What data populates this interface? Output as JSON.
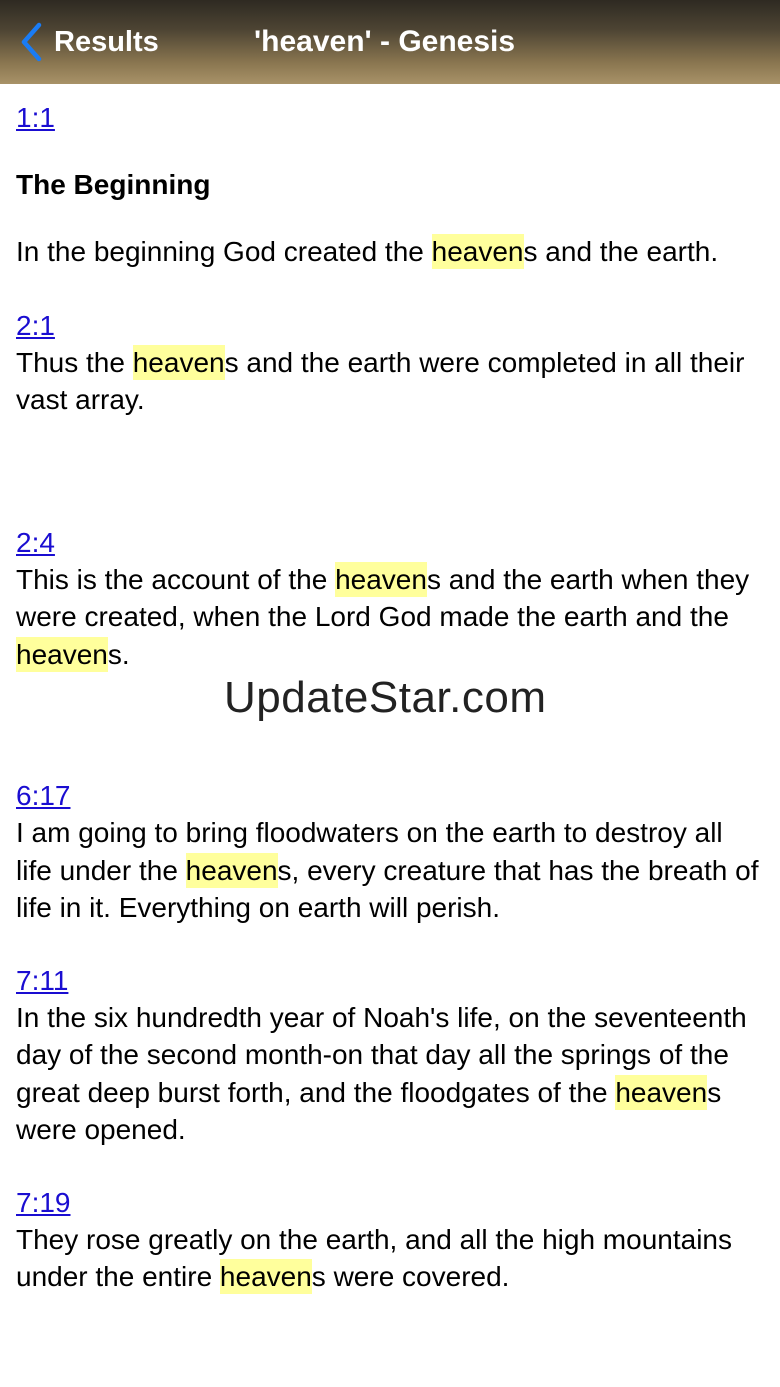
{
  "nav": {
    "back_label": "Results",
    "title": "'heaven' - Genesis"
  },
  "results": [
    {
      "ref": "1:1",
      "heading": "The Beginning",
      "before": "In the beginning God created the ",
      "hl": "heaven",
      "after": "s and the earth."
    },
    {
      "ref": "2:1",
      "before": "Thus the ",
      "hl": "heaven",
      "after": "s and the earth were completed in all their vast array."
    },
    {
      "ref": "2:4",
      "before": "This is the account of the ",
      "hl": "heaven",
      "after": "s and the earth when they were created, when the Lord God made the earth and the ",
      "hl2": "heaven",
      "after2": "s."
    },
    {
      "ref": "6:17",
      "before": "I am going to bring floodwaters on the earth to destroy all life under the ",
      "hl": "heaven",
      "after": "s, every creature that has the breath of life in it. Everything on earth will perish."
    },
    {
      "ref": "7:11",
      "before": "In the six hundredth year of Noah's life, on the seventeenth day of the second month-on that day all the springs of the great deep burst forth, and the floodgates of the ",
      "hl": "heaven",
      "after": "s were opened."
    },
    {
      "ref": "7:19",
      "before": "They rose greatly on the earth, and all the high mountains under the entire ",
      "hl": "heaven",
      "after": "s were covered."
    }
  ],
  "watermark": "UpdateStar.com",
  "colors": {
    "link": "#1a0dd1",
    "highlight": "#ffff9c",
    "back_chevron": "#1a7cf5"
  }
}
